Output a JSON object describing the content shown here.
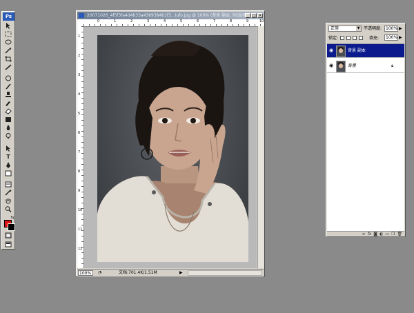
{
  "app": {
    "logo": "Ps"
  },
  "document": {
    "title": "20071026_4f5f3fa4d4b33a4369384b1f3...Iufo.jpg @ 100% (背景 副本, RGB/8)",
    "zoom": "100%",
    "doc_size": "文档:701.4K/1.51M",
    "status_arrow": "▶",
    "ruler_top_labels": [
      "0",
      "1",
      "2",
      "3",
      "4",
      "5",
      "6",
      "7",
      "8",
      "9",
      "10"
    ],
    "ruler_left_labels": [
      "1",
      "2",
      "3",
      "4",
      "5",
      "6",
      "7",
      "8",
      "9",
      "10",
      "11",
      "12"
    ]
  },
  "layers_panel": {
    "blend_mode": "正常",
    "opacity_label": "不透明度:",
    "opacity_value": "100%",
    "lock_label": "锁定:",
    "fill_label": "填充:",
    "fill_value": "100%",
    "layers": [
      {
        "name": "背景 副本",
        "selected": true
      },
      {
        "name": "背景",
        "selected": false
      }
    ]
  },
  "colors": {
    "foreground": "#e01010",
    "background": "#000000",
    "selection": "#0b1b8e"
  }
}
